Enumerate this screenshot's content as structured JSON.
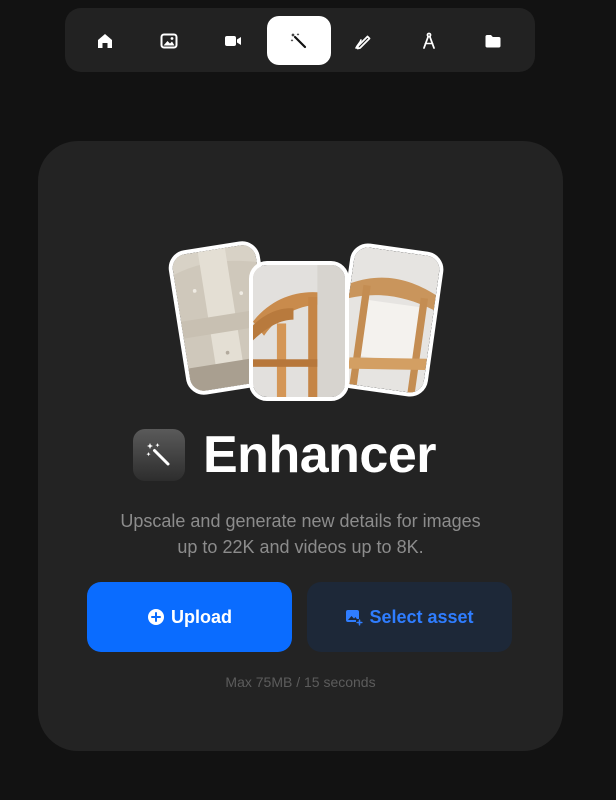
{
  "toolbar": {
    "items": [
      {
        "icon": "home-icon",
        "active": false
      },
      {
        "icon": "image-icon",
        "active": false
      },
      {
        "icon": "video-icon",
        "active": false
      },
      {
        "icon": "magic-wand-icon",
        "active": true
      },
      {
        "icon": "pen-icon",
        "active": false
      },
      {
        "icon": "compass-icon",
        "active": false
      },
      {
        "icon": "folder-icon",
        "active": false
      }
    ]
  },
  "main": {
    "title": "Enhancer",
    "description_line1": "Upscale and generate new details for images",
    "description_line2": "up to 22K and videos up to 8K.",
    "upload_label": "Upload",
    "select_asset_label": "Select asset",
    "limit_text": "Max 75MB / 15 seconds"
  },
  "colors": {
    "background": "#121212",
    "card": "#232323",
    "primary": "#0a6cff",
    "secondary_bg": "#1d2838",
    "secondary_text": "#2f7dff"
  }
}
